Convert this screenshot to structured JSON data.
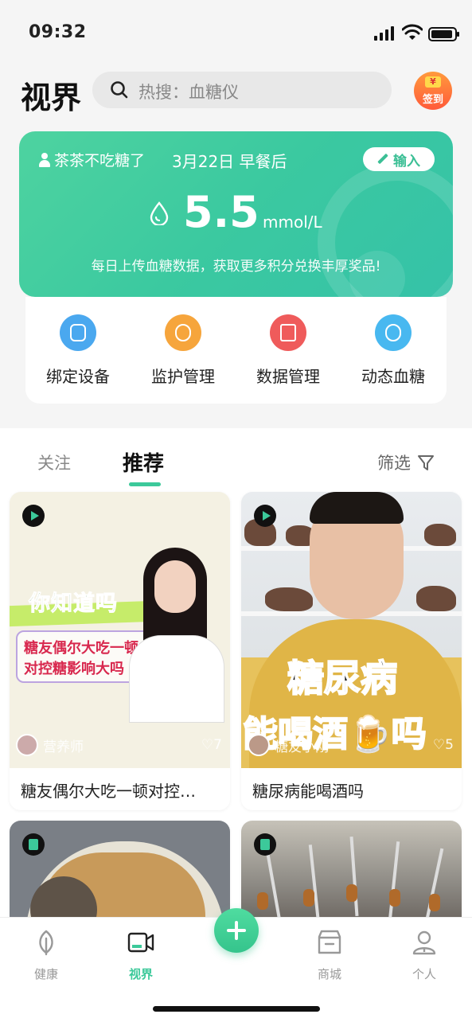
{
  "status_bar": {
    "time": "09:32"
  },
  "header": {
    "title": "视界",
    "search_placeholder": "热搜：血糖仪",
    "signin_label": "签到",
    "signin_badge": "¥"
  },
  "glucose_card": {
    "user": "茶茶不吃糖了",
    "date": "3月22日 早餐后",
    "input_button": "输入",
    "value": "5.5",
    "unit": "mmol/L",
    "tip": "每日上传血糖数据，获取更多积分兑换丰厚奖品!"
  },
  "quick_menu": [
    {
      "label": "绑定设备",
      "icon": "device-icon",
      "color": "#4aa8ef"
    },
    {
      "label": "监护管理",
      "icon": "guardians-icon",
      "color": "#f6a53c"
    },
    {
      "label": "数据管理",
      "icon": "chart-icon",
      "color": "#ef5b5b"
    },
    {
      "label": "动态血糖",
      "icon": "sensor-icon",
      "color": "#48b8f0"
    }
  ],
  "tabs": {
    "follow": "关注",
    "recommend": "推荐",
    "filter": "筛选"
  },
  "cards": [
    {
      "title": "糖友偶尔大吃一顿对控…",
      "type": "video",
      "author": "营养师",
      "likes": "7",
      "art": {
        "headline": "你知道吗",
        "line1": "糖友偶尔大吃一顿",
        "line2": "对控糖影响大吗"
      }
    },
    {
      "title": "糖尿病能喝酒吗",
      "type": "video",
      "author": "糖友小刚",
      "likes": "5",
      "art": {
        "headline": "糖尿病",
        "line2": "能喝酒🍺吗"
      }
    },
    {
      "title": "",
      "type": "note"
    },
    {
      "title": "",
      "type": "note"
    }
  ],
  "bottom_nav": [
    {
      "label": "健康",
      "icon": "leaf-icon",
      "active": false
    },
    {
      "label": "视界",
      "icon": "video-camera-icon",
      "active": true
    },
    {
      "label": "商城",
      "icon": "store-icon",
      "active": false
    },
    {
      "label": "个人",
      "icon": "person-icon",
      "active": false
    }
  ],
  "colors": {
    "accent": "#3cc99a",
    "card_green": "#45cda0"
  }
}
